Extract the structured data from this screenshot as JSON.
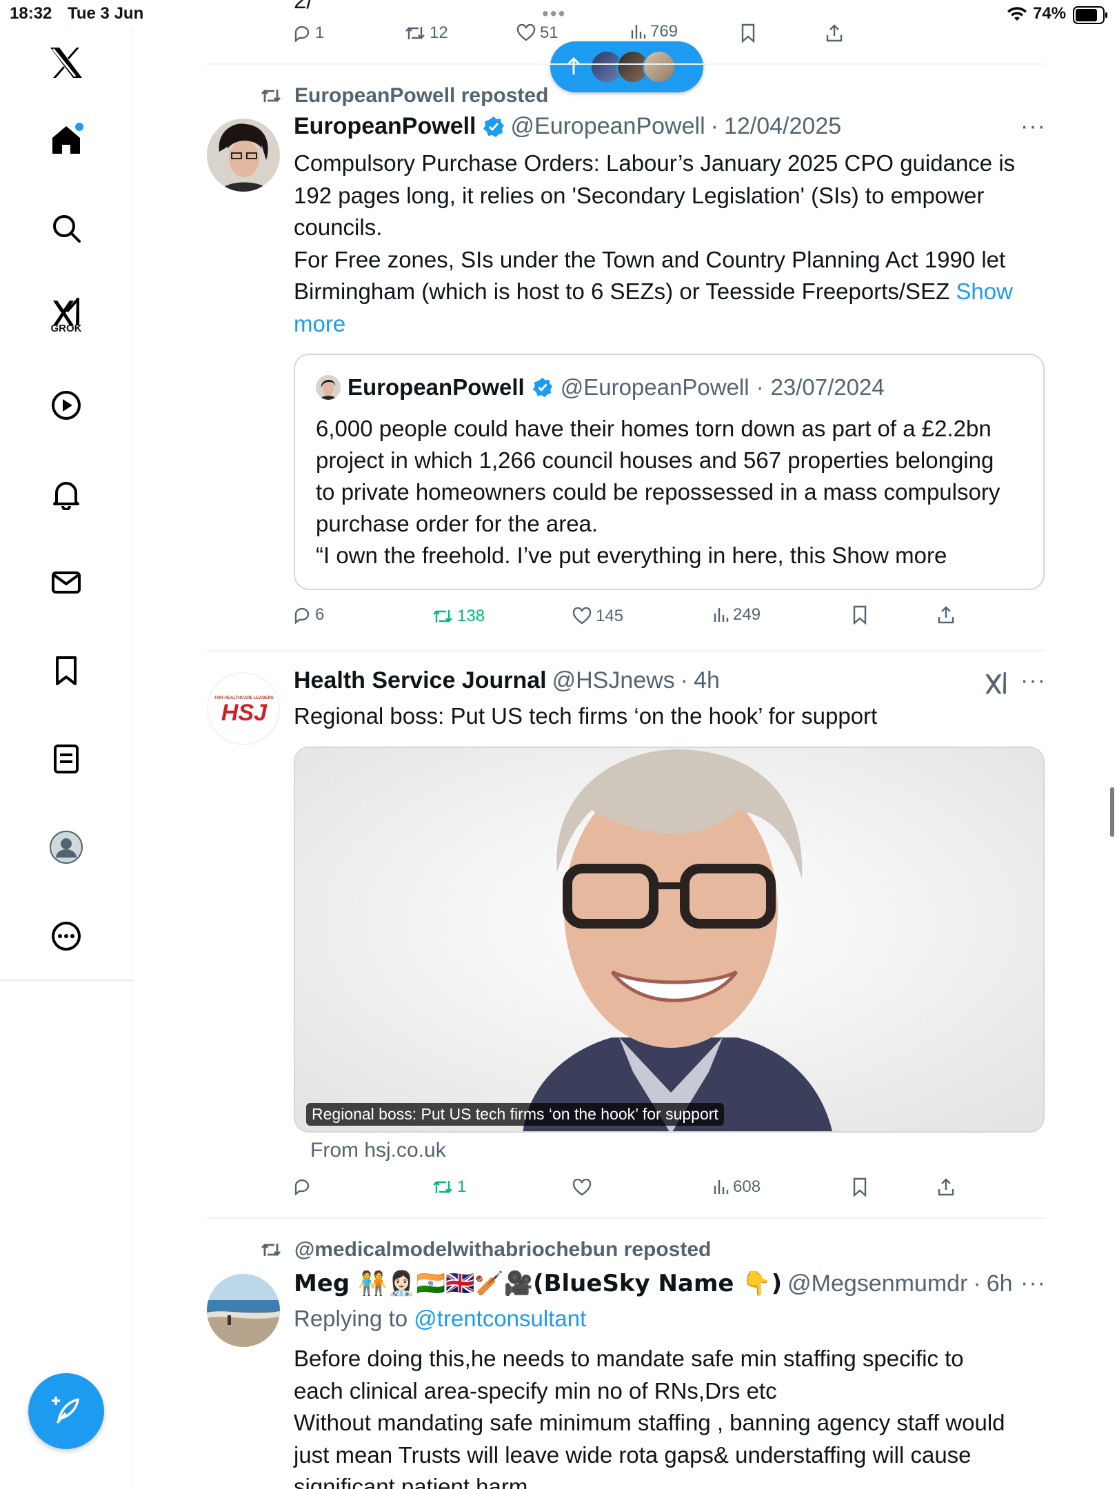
{
  "status_bar": {
    "time": "18:32",
    "date": "Tue 3 Jun",
    "battery": "74%"
  },
  "sidebar": {
    "grok_label": "GROK"
  },
  "top_partial": {
    "cut_text": "2/"
  },
  "top_actions": {
    "replies": "1",
    "reposts": "12",
    "likes": "51",
    "views": "769"
  },
  "tweets": [
    {
      "repost_by": "EuropeanPowell reposted",
      "name": "EuropeanPowell",
      "handle": "@EuropeanPowell",
      "dot": "·",
      "time": "12/04/2025",
      "lines": [
        "Compulsory Purchase Orders: Labour’s January 2025 CPO guidance is",
        "192 pages long, it relies on 'Secondary Legislation' (SIs) to empower",
        "councils.",
        "For Free zones, SIs under the Town and Country Planning Act 1990 let",
        "Birmingham (which is host to 6 SEZs) or Teesside Freeports/SEZ"
      ],
      "show_more_1": "Show",
      "show_more_2": "more",
      "quote": {
        "name": "EuropeanPowell",
        "handle": "@EuropeanPowell",
        "time": "23/07/2024",
        "lines": [
          "6,000 people could have their homes torn down as part of a £2.2bn",
          "project in which 1,266 council houses and 567 properties belonging",
          "to private homeowners could be repossessed in a mass compulsory",
          "purchase order for the area.",
          "“I own the freehold. I’ve put everything in here, this Show more"
        ]
      },
      "actions": {
        "replies": "6",
        "reposts": "138",
        "likes": "145",
        "views": "249"
      }
    },
    {
      "name": "Health Service Journal",
      "handle": "@HSJnews",
      "time": "4h",
      "avatar_text": "HSJ",
      "avatar_small": "FOR HEALTHCARE LEADERS",
      "text": "Regional boss: Put US tech firms ‘on the hook’ for support",
      "media_caption": "Regional boss: Put US tech firms ‘on the hook’ for support",
      "from": "From hsj.co.uk",
      "actions": {
        "replies": "",
        "reposts": "1",
        "likes": "",
        "views": "608"
      }
    },
    {
      "repost_by": "@medicalmodelwithabriochebun reposted",
      "name": "Meg 🧑‍🤝‍🧑👩🏻‍⚕️🇮🇳🇬🇧🏏🎥(BlueSky Name 👇)",
      "handle": "@Megsenmumdr",
      "time": "6h",
      "replying_prefix": "Replying to",
      "replying_to": "@trentconsultant",
      "lines": [
        "Before doing this,he needs to mandate safe min staffing specific to",
        "each clinical area-specify min no of RNs,Drs etc",
        "Without mandating safe minimum staffing , banning agency staff would",
        "just mean Trusts will leave wide rota gaps& understaffing will cause",
        "significant patient harm"
      ]
    }
  ],
  "colors": {
    "accent": "#1d9bf0",
    "repost_green": "#00ba7c",
    "muted": "#536471"
  }
}
